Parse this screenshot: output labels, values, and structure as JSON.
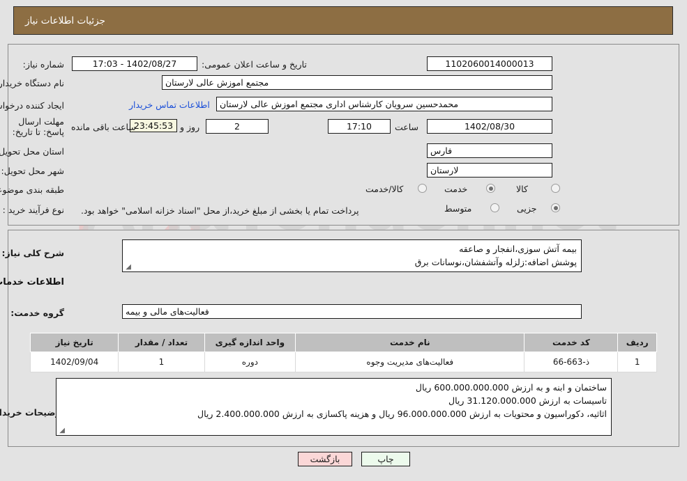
{
  "header": {
    "title": "جزئیات اطلاعات نیاز",
    "bar_color": "#8d6e43"
  },
  "form": {
    "need_number_label": "شماره نیاز:",
    "need_number_value": "1102060014000013",
    "public_announce_label": "تاریخ و ساعت اعلان عمومی:",
    "public_announce_value": "1402/08/27 - 17:03",
    "buyer_org_label": "نام دستگاه خریدار:",
    "buyer_org_value": "مجتمع اموزش عالی لارستان",
    "buyer_org_value2": "داری مجتمع اموزش عالی لارستان",
    "requester_label": "ایجاد کننده درخواست:",
    "requester_value": "محمدحسین سرویان کارشناس اداری مجتمع اموزش عالی لارستان",
    "contact_link": "اطلاعات تماس خریدار",
    "deadline_label": "مهلت ارسال پاسخ: تا تاریخ:",
    "deadline_date": "1402/08/30",
    "hour_label": "ساعت",
    "hour_value": "17:10",
    "days_value": "2",
    "days_and_label": "روز و",
    "countdown_value": "23:45:53",
    "countdown_suffix": "ساعت باقی مانده",
    "province_label": "استان محل تحویل:",
    "province_value": "فارس",
    "city_label": "شهر محل تحویل:",
    "city_value": "لارستان",
    "category_label": "طبقه بندی موضوعی:",
    "category_options": [
      {
        "label": "کالا",
        "selected": false
      },
      {
        "label": "خدمت",
        "selected": true
      },
      {
        "label": "کالا/خدمت",
        "selected": false
      }
    ],
    "process_label": "نوع فرآیند خرید :",
    "process_options": [
      {
        "label": "جزیی",
        "selected": true
      },
      {
        "label": "متوسط",
        "selected": false
      }
    ],
    "treasury_note": "پرداخت تمام یا بخشی از مبلغ خرید،از محل \"اسناد خزانه اسلامی\" خواهد بود."
  },
  "description": {
    "label": "شرح کلی نیاز:",
    "line1": "بیمه آتش سوزی،انفجار و صاعقه",
    "line2": "پوشش اضافه:زلزله وآتشفشان،نوسانات برق"
  },
  "services_section": {
    "heading": "اطلاعات خدمات مورد نیاز",
    "group_label": "گروه خدمت:",
    "group_value": "فعالیت‌های مالی و بیمه"
  },
  "table": {
    "columns": [
      "ردیف",
      "کد خدمت",
      "نام خدمت",
      "واحد اندازه گیری",
      "تعداد / مقدار",
      "تاریخ نیاز"
    ],
    "rows": [
      {
        "row": "1",
        "code": "ذ-663-66",
        "name": "فعالیت‌های مدیریت وجوه",
        "unit": "دوره",
        "qty": "1",
        "date": "1402/09/04"
      }
    ]
  },
  "buyer_notes": {
    "label": "توضیحات خریدار:",
    "line1": "ساختمان و ابنه و  به ارزش 600.000.000.000 ریال",
    "line2": "تاسیسات به ارزش 31.120.000.000 ریال",
    "line3": "اثاثیه، دکوراسیون و محتویات به ارزش 96.000.000.000 ریال و هزینه پاکسازی به ارزش 2.400.000.000 ریال"
  },
  "footer": {
    "print_label": "چاپ",
    "back_label": "بازگشت"
  },
  "watermark": {
    "text": "AnaTender.net"
  }
}
